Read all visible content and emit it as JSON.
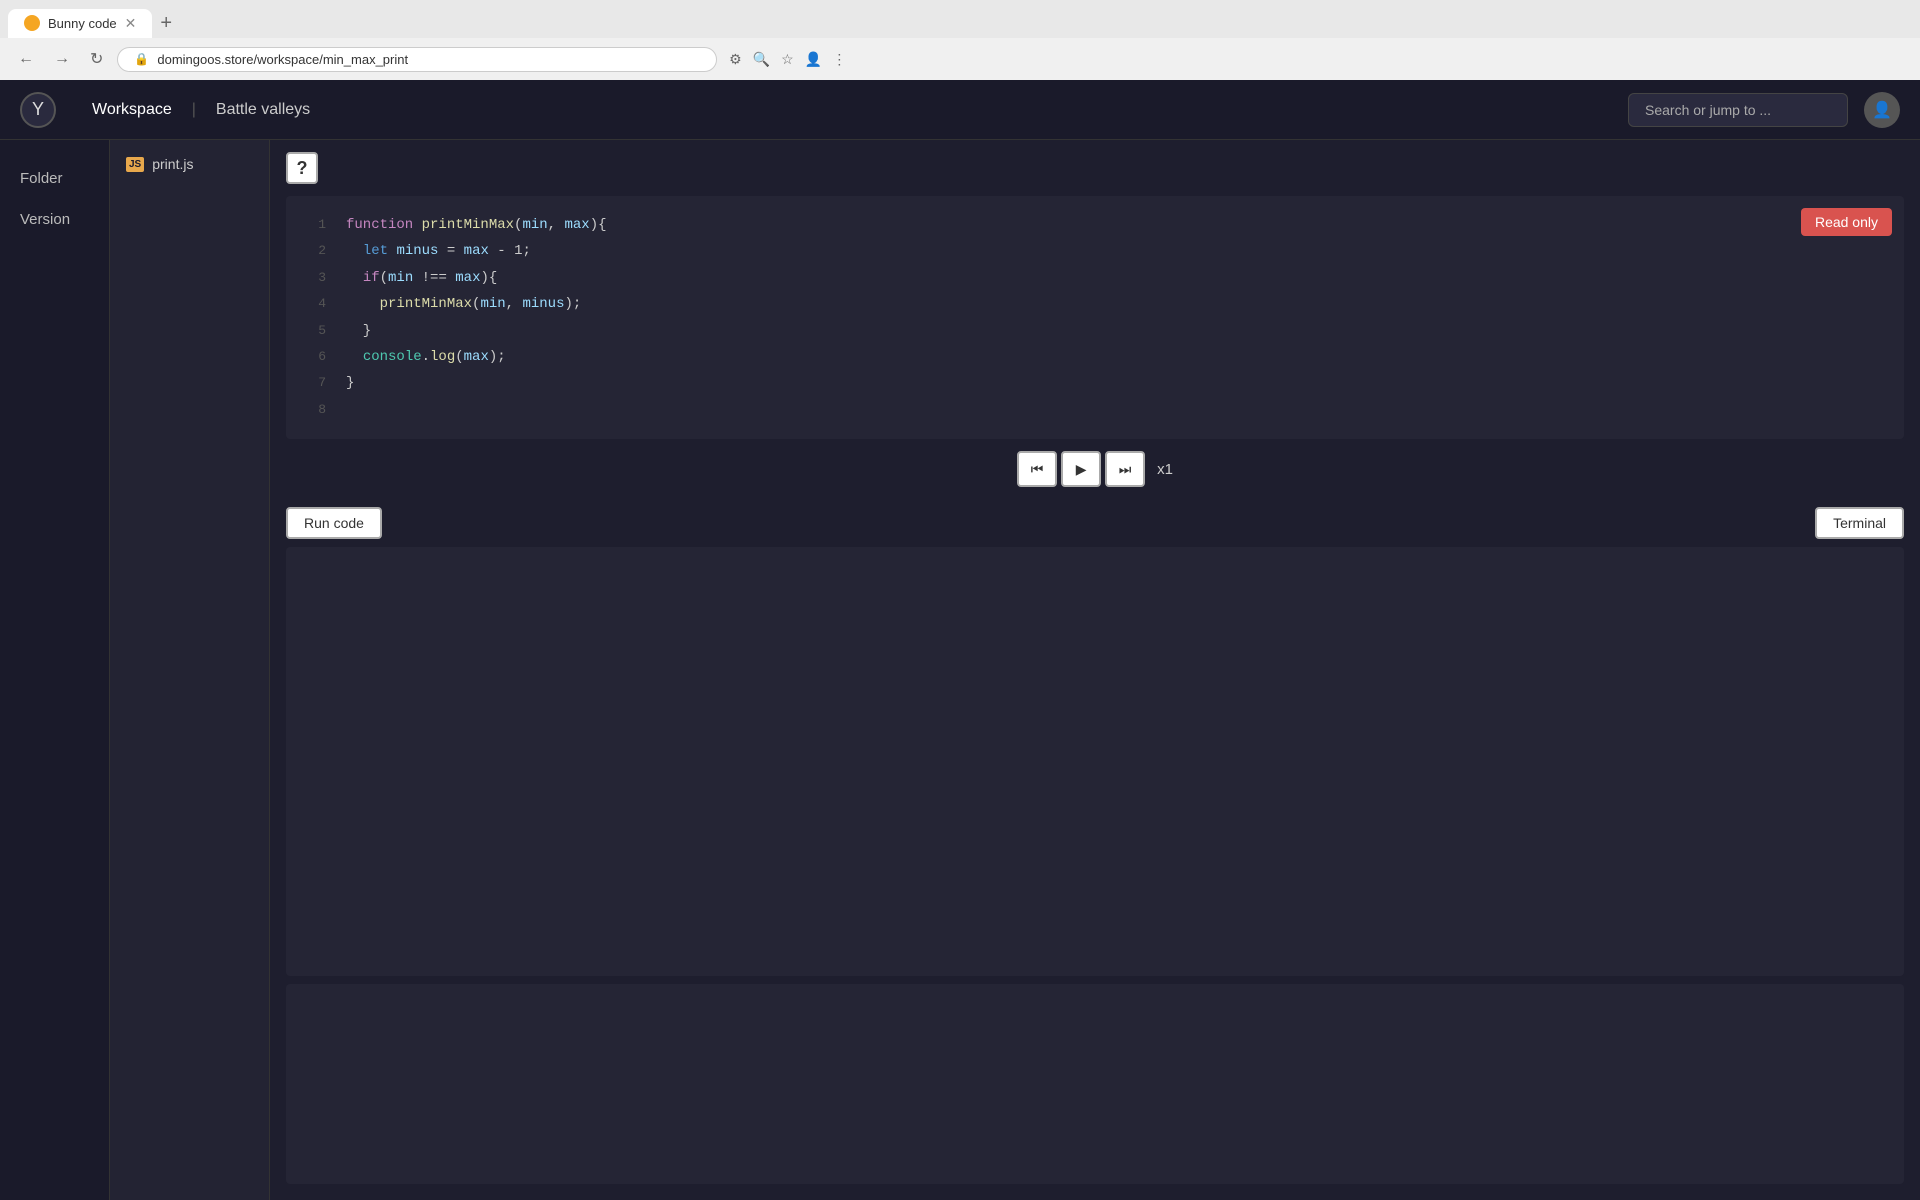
{
  "browser": {
    "tab_title": "Bunny code",
    "tab_favicon": "🐰",
    "new_tab_icon": "+",
    "address": "domingoos.store/workspace/min_max_print",
    "nav_back": "←",
    "nav_forward": "→",
    "nav_reload": "↻"
  },
  "nav": {
    "logo_symbol": "Y",
    "workspace_label": "Workspace",
    "separator": "|",
    "battle_valleys_label": "Battle valleys",
    "search_placeholder": "Search or jump to ...",
    "avatar_symbol": "👤"
  },
  "sidebar": {
    "items": [
      {
        "label": "Folder"
      },
      {
        "label": "Version"
      }
    ]
  },
  "file_panel": {
    "file_name": "print.js",
    "file_icon_text": "JS"
  },
  "editor": {
    "help_symbol": "?",
    "read_only_label": "Read only",
    "lines": [
      {
        "num": "1",
        "html": "<span class='kw'>function</span> <span class='fn'>printMinMax</span>(<span class='param'>min</span>, <span class='param'>max</span>){"
      },
      {
        "num": "2",
        "html": "&nbsp;&nbsp;<span class='kw2'>let</span> <span class='param'>minus</span> = <span class='param'>max</span> - 1;"
      },
      {
        "num": "3",
        "html": "&nbsp;&nbsp;<span class='kw'>if</span>(<span class='param'>min</span> !== <span class='param'>max</span>){"
      },
      {
        "num": "4",
        "html": "&nbsp;&nbsp;&nbsp;&nbsp;<span class='fn'>printMinMax</span>(<span class='param'>min</span>, <span class='param'>minus</span>);"
      },
      {
        "num": "5",
        "html": "&nbsp;&nbsp;}"
      },
      {
        "num": "6",
        "html": "&nbsp;&nbsp;<span class='obj'>console</span>.<span class='method'>log</span>(<span class='param'>max</span>);"
      },
      {
        "num": "7",
        "html": "}"
      },
      {
        "num": "8",
        "html": ""
      }
    ]
  },
  "playback": {
    "rewind_icon": "⏮",
    "play_icon": "▶",
    "fast_forward_icon": "⏭",
    "speed_label": "x1"
  },
  "footer": {
    "run_code_label": "Run code",
    "terminal_label": "Terminal"
  }
}
